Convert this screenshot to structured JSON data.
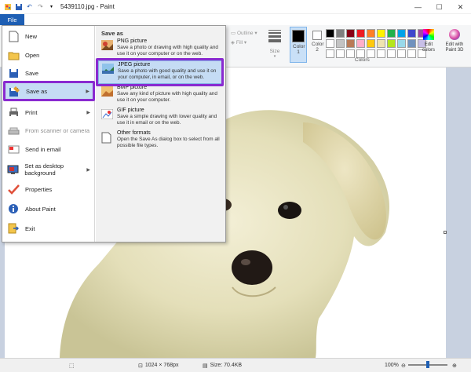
{
  "window": {
    "title": "5439110.jpg - Paint",
    "minimize": "—",
    "maximize": "☐",
    "close": "✕"
  },
  "ribbon": {
    "file_tab": "File",
    "outline_label": "Outline",
    "fill_label": "Fill",
    "size_label": "Size",
    "color1_label": "Color 1",
    "color2_label": "Color 2",
    "colors_group_label": "Colors",
    "edit_colors_label": "Edit colors",
    "edit_p3d_label": "Edit with Paint 3D",
    "color1_value": "#000000",
    "color2_value": "#ffffff",
    "palette": [
      "#000000",
      "#7f7f7f",
      "#880015",
      "#ed1c24",
      "#ff7f27",
      "#fff200",
      "#22b14c",
      "#00a2e8",
      "#3f48cc",
      "#a349a4",
      "#ffffff",
      "#c3c3c3",
      "#b97a57",
      "#ffaec9",
      "#ffc90e",
      "#efe4b0",
      "#b5e61d",
      "#99d9ea",
      "#7092be",
      "#c8bfe7",
      "#ffffff",
      "#ffffff",
      "#ffffff",
      "#ffffff",
      "#ffffff",
      "#ffffff",
      "#ffffff",
      "#ffffff",
      "#ffffff",
      "#ffffff"
    ]
  },
  "file_menu": {
    "items": [
      {
        "label": "New",
        "icon": "new-file-icon"
      },
      {
        "label": "Open",
        "icon": "open-folder-icon"
      },
      {
        "label": "Save",
        "icon": "save-icon"
      },
      {
        "label": "Save as",
        "icon": "save-as-icon",
        "has_submenu": true
      },
      {
        "label": "Print",
        "icon": "printer-icon",
        "has_submenu": true
      },
      {
        "label": "From scanner or camera",
        "icon": "scanner-icon",
        "disabled": true
      },
      {
        "label": "Send in email",
        "icon": "email-icon"
      },
      {
        "label": "Set as desktop background",
        "icon": "desktop-icon",
        "has_submenu": true
      },
      {
        "label": "Properties",
        "icon": "checkmark-icon"
      },
      {
        "label": "About Paint",
        "icon": "info-icon"
      },
      {
        "label": "Exit",
        "icon": "exit-icon"
      }
    ]
  },
  "save_as": {
    "header": "Save as",
    "items": [
      {
        "title": "PNG picture",
        "desc": "Save a photo or drawing with high quality and use it on your computer or on the web."
      },
      {
        "title": "JPEG picture",
        "desc": "Save a photo with good quality and use it on your computer, in email, or on the web."
      },
      {
        "title": "BMP picture",
        "desc": "Save any kind of picture with high quality and use it on your computer."
      },
      {
        "title": "GIF picture",
        "desc": "Save a simple drawing with lower quality and use it in email or on the web."
      },
      {
        "title": "Other formats",
        "desc": "Open the Save As dialog box to select from all possible file types."
      }
    ]
  },
  "statusbar": {
    "dimensions": "1024 × 768px",
    "size": "Size: 70.4KB",
    "zoom": "100%",
    "zoom_fraction": 0.45
  },
  "highlight_color": "#8a2ad0"
}
